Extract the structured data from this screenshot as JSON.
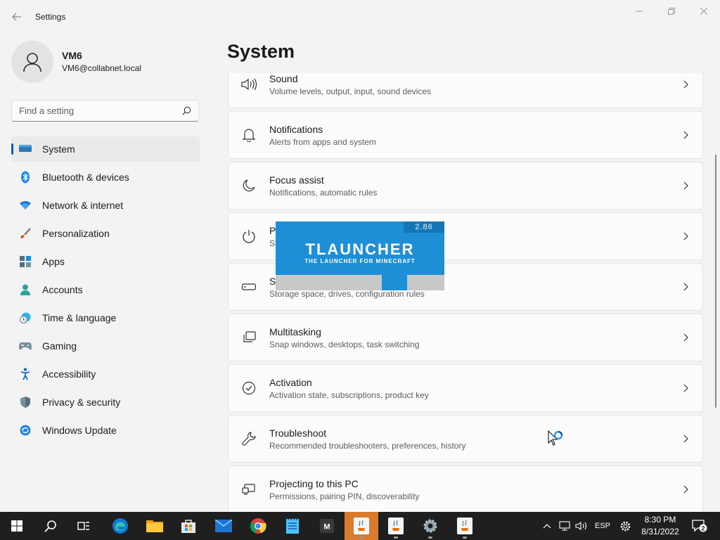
{
  "window": {
    "title": "Settings",
    "back_icon": "back-arrow-icon",
    "controls": [
      "minimize-icon",
      "maximize-icon",
      "close-icon"
    ]
  },
  "profile": {
    "name": "VM6",
    "email": "VM6@collabnet.local"
  },
  "search": {
    "placeholder": "Find a setting"
  },
  "sidebar": {
    "items": [
      {
        "label": "System",
        "icon": "system-icon",
        "active": true
      },
      {
        "label": "Bluetooth & devices",
        "icon": "bluetooth-icon"
      },
      {
        "label": "Network & internet",
        "icon": "network-icon"
      },
      {
        "label": "Personalization",
        "icon": "brush-icon"
      },
      {
        "label": "Apps",
        "icon": "apps-icon"
      },
      {
        "label": "Accounts",
        "icon": "accounts-icon"
      },
      {
        "label": "Time & language",
        "icon": "clock-globe-icon"
      },
      {
        "label": "Gaming",
        "icon": "gamepad-icon"
      },
      {
        "label": "Accessibility",
        "icon": "accessibility-icon"
      },
      {
        "label": "Privacy & security",
        "icon": "shield-icon"
      },
      {
        "label": "Windows Update",
        "icon": "windows-update-icon"
      }
    ]
  },
  "main": {
    "title": "System",
    "cards": [
      {
        "title": "Sound",
        "subtitle": "Volume levels, output, input, sound devices",
        "icon": "speaker-icon"
      },
      {
        "title": "Notifications",
        "subtitle": "Alerts from apps and system",
        "icon": "bell-icon"
      },
      {
        "title": "Focus assist",
        "subtitle": "Notifications, automatic rules",
        "icon": "moon-icon"
      },
      {
        "title": "P",
        "subtitle": "Sl",
        "icon": "power-icon"
      },
      {
        "title": "St",
        "subtitle": "Storage space, drives, configuration rules",
        "icon": "drive-icon"
      },
      {
        "title": "Multitasking",
        "subtitle": "Snap windows, desktops, task switching",
        "icon": "multitasking-icon"
      },
      {
        "title": "Activation",
        "subtitle": "Activation state, subscriptions, product key",
        "icon": "check-circle-icon"
      },
      {
        "title": "Troubleshoot",
        "subtitle": "Recommended troubleshooters, preferences, history",
        "icon": "wrench-icon"
      },
      {
        "title": "Projecting to this PC",
        "subtitle": "Permissions, pairing PIN, discoverability",
        "icon": "projector-icon"
      }
    ]
  },
  "splash": {
    "app": "TLAUNCHER",
    "tagline": "THE LAUNCHER FOR MINECRAFT",
    "version": "2.86",
    "progress_segment": [
      0.63,
      0.78
    ]
  },
  "taskbar": {
    "apps": [
      "windows-start-icon",
      "search-icon",
      "task-view-icon",
      "edge-icon",
      "file-explorer-icon",
      "store-icon",
      "mail-icon",
      "chrome-icon",
      "notepad-icon",
      "m-app-icon",
      "java-icon",
      "java-icon",
      "settings-gear-icon",
      "java-icon"
    ],
    "tray": {
      "language": "ESP",
      "time": "8:30 PM",
      "date": "8/31/2022",
      "notifications": "2"
    }
  },
  "colors": {
    "accent": "#005fb8",
    "background": "#f3f3f3",
    "taskbar": "#1f1f1f",
    "tlauncher_blue": "#1e8fd6"
  }
}
